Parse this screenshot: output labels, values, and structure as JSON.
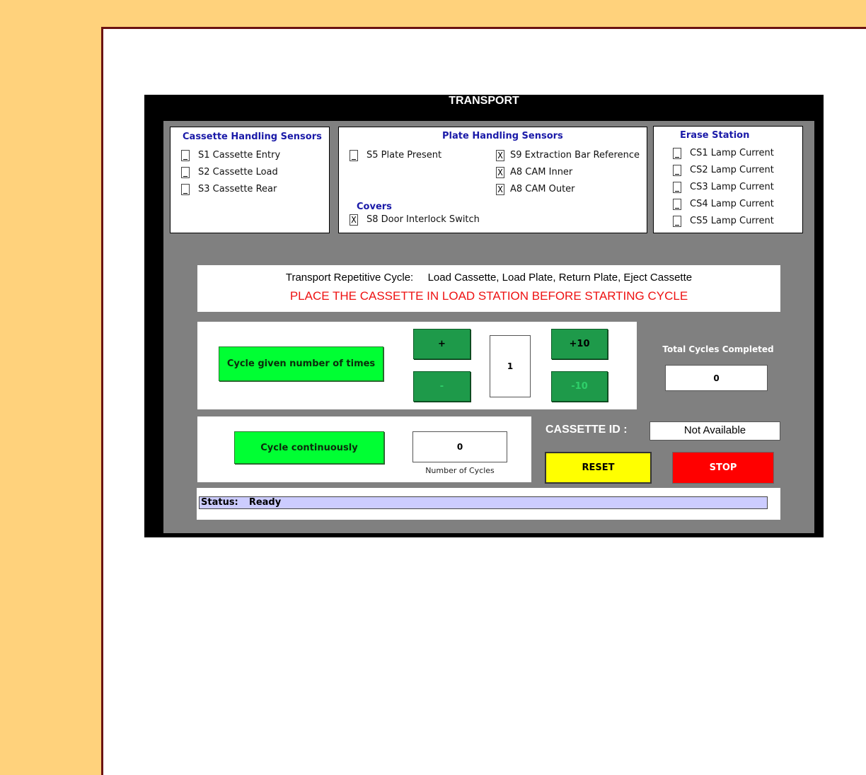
{
  "window": {
    "title": "TRANSPORT"
  },
  "cassette_sensors": {
    "title": "Cassette Handling Sensors",
    "items": [
      {
        "mark": "",
        "label": "S1 Cassette Entry"
      },
      {
        "mark": "",
        "label": "S2 Cassette Load"
      },
      {
        "mark": "",
        "label": "S3 Cassette Rear"
      }
    ]
  },
  "plate_sensors": {
    "title": "Plate Handling Sensors",
    "left": [
      {
        "mark": "",
        "label": "S5 Plate Present"
      }
    ],
    "right": [
      {
        "mark": "X",
        "label": "S9 Extraction Bar Reference"
      },
      {
        "mark": "X",
        "label": "A8 CAM Inner"
      },
      {
        "mark": "X",
        "label": "A8 CAM Outer"
      }
    ],
    "covers_title": "Covers",
    "covers": [
      {
        "mark": "X",
        "label": "S8 Door Interlock Switch"
      }
    ]
  },
  "erase_station": {
    "title": "Erase Station",
    "items": [
      {
        "mark": "",
        "label": "CS1 Lamp Current"
      },
      {
        "mark": "",
        "label": "CS2 Lamp Current"
      },
      {
        "mark": "",
        "label": "CS3 Lamp Current"
      },
      {
        "mark": "",
        "label": "CS4 Lamp Current"
      },
      {
        "mark": "",
        "label": "CS5 Lamp Current"
      }
    ]
  },
  "cycle_info": {
    "label": "Transport Repetitive Cycle:",
    "steps": "Load Cassette, Load Plate, Return Plate, Eject Cassette",
    "warning": "PLACE THE CASSETTE IN LOAD STATION BEFORE STARTING CYCLE",
    "warning_color": "#ee1111"
  },
  "cycle_given": {
    "button_label": "Cycle given number of times",
    "plus_label": "+",
    "minus_label": "-",
    "plus10_label": "+10",
    "minus10_label": "-10",
    "count_value": "1"
  },
  "total_cycles": {
    "label": "Total Cycles Completed",
    "value": "0"
  },
  "cycle_continuous": {
    "button_label": "Cycle continuously",
    "cycles_value": "0",
    "cycles_caption": "Number of Cycles"
  },
  "cassette_id": {
    "label": "CASSETTE ID :",
    "value": "Not Available"
  },
  "controls": {
    "reset_label": "RESET",
    "stop_label": "STOP",
    "reset_color": "#ffff00",
    "stop_color": "#ff0000"
  },
  "status": {
    "label": "Status:",
    "value": "Ready"
  }
}
